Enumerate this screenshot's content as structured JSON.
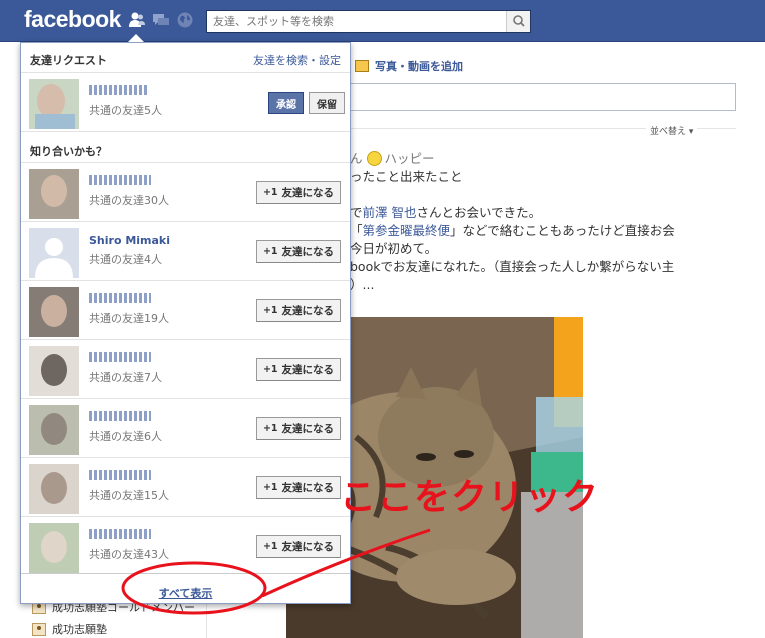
{
  "topbar": {
    "logo": "facebook",
    "search_placeholder": "友達、スポット等を検索"
  },
  "composer": {
    "add_photo_label": "写真・動画を追加"
  },
  "feed": {
    "sort_label": "並べ替え",
    "post": {
      "line1_a": "ん",
      "line1_b": "ハッピー",
      "line2": "ったこと出来たこと",
      "line3_a": "で",
      "line3_name": "前澤 智也",
      "line3_b": "さんとお会いできた。",
      "line4_a": "「",
      "line4_link": "第参金曜最終便",
      "line4_b": "」などで絡むこともあったけど直接お会",
      "line5": "今日が初めて。",
      "line6": "bookでお友達になれた。（直接会った人しか繋がらない主",
      "line7": "）..."
    }
  },
  "left_nav": {
    "items": [
      "成功志願塾ゴールドメンバー",
      "成功志願塾"
    ]
  },
  "friend_requests": {
    "title": "友達リクエスト",
    "links": "友達を検索・設定",
    "request": {
      "mutual": "共通の友達5人",
      "confirm_label": "承認",
      "hold_label": "保留"
    },
    "pymk_title": "知り合いかも？",
    "suggestions": [
      {
        "name": "",
        "mutual": "共通の友達30人"
      },
      {
        "name": "Shiro Mimaki",
        "mutual": "共通の友達4人"
      },
      {
        "name": "",
        "mutual": "共通の友達19人"
      },
      {
        "name": "",
        "mutual": "共通の友達7人"
      },
      {
        "name": "",
        "mutual": "共通の友達6人"
      },
      {
        "name": "",
        "mutual": "共通の友達15人"
      },
      {
        "name": "",
        "mutual": "共通の友達43人"
      }
    ],
    "add_friend_label": "友達になる",
    "add_friend_plus": "+1",
    "see_all": "すべて表示"
  },
  "annotation": {
    "text": "ここをクリック",
    "color": "#e8121c"
  },
  "colors": {
    "brand": "#3b5998",
    "annotation_red": "#e8121c"
  }
}
